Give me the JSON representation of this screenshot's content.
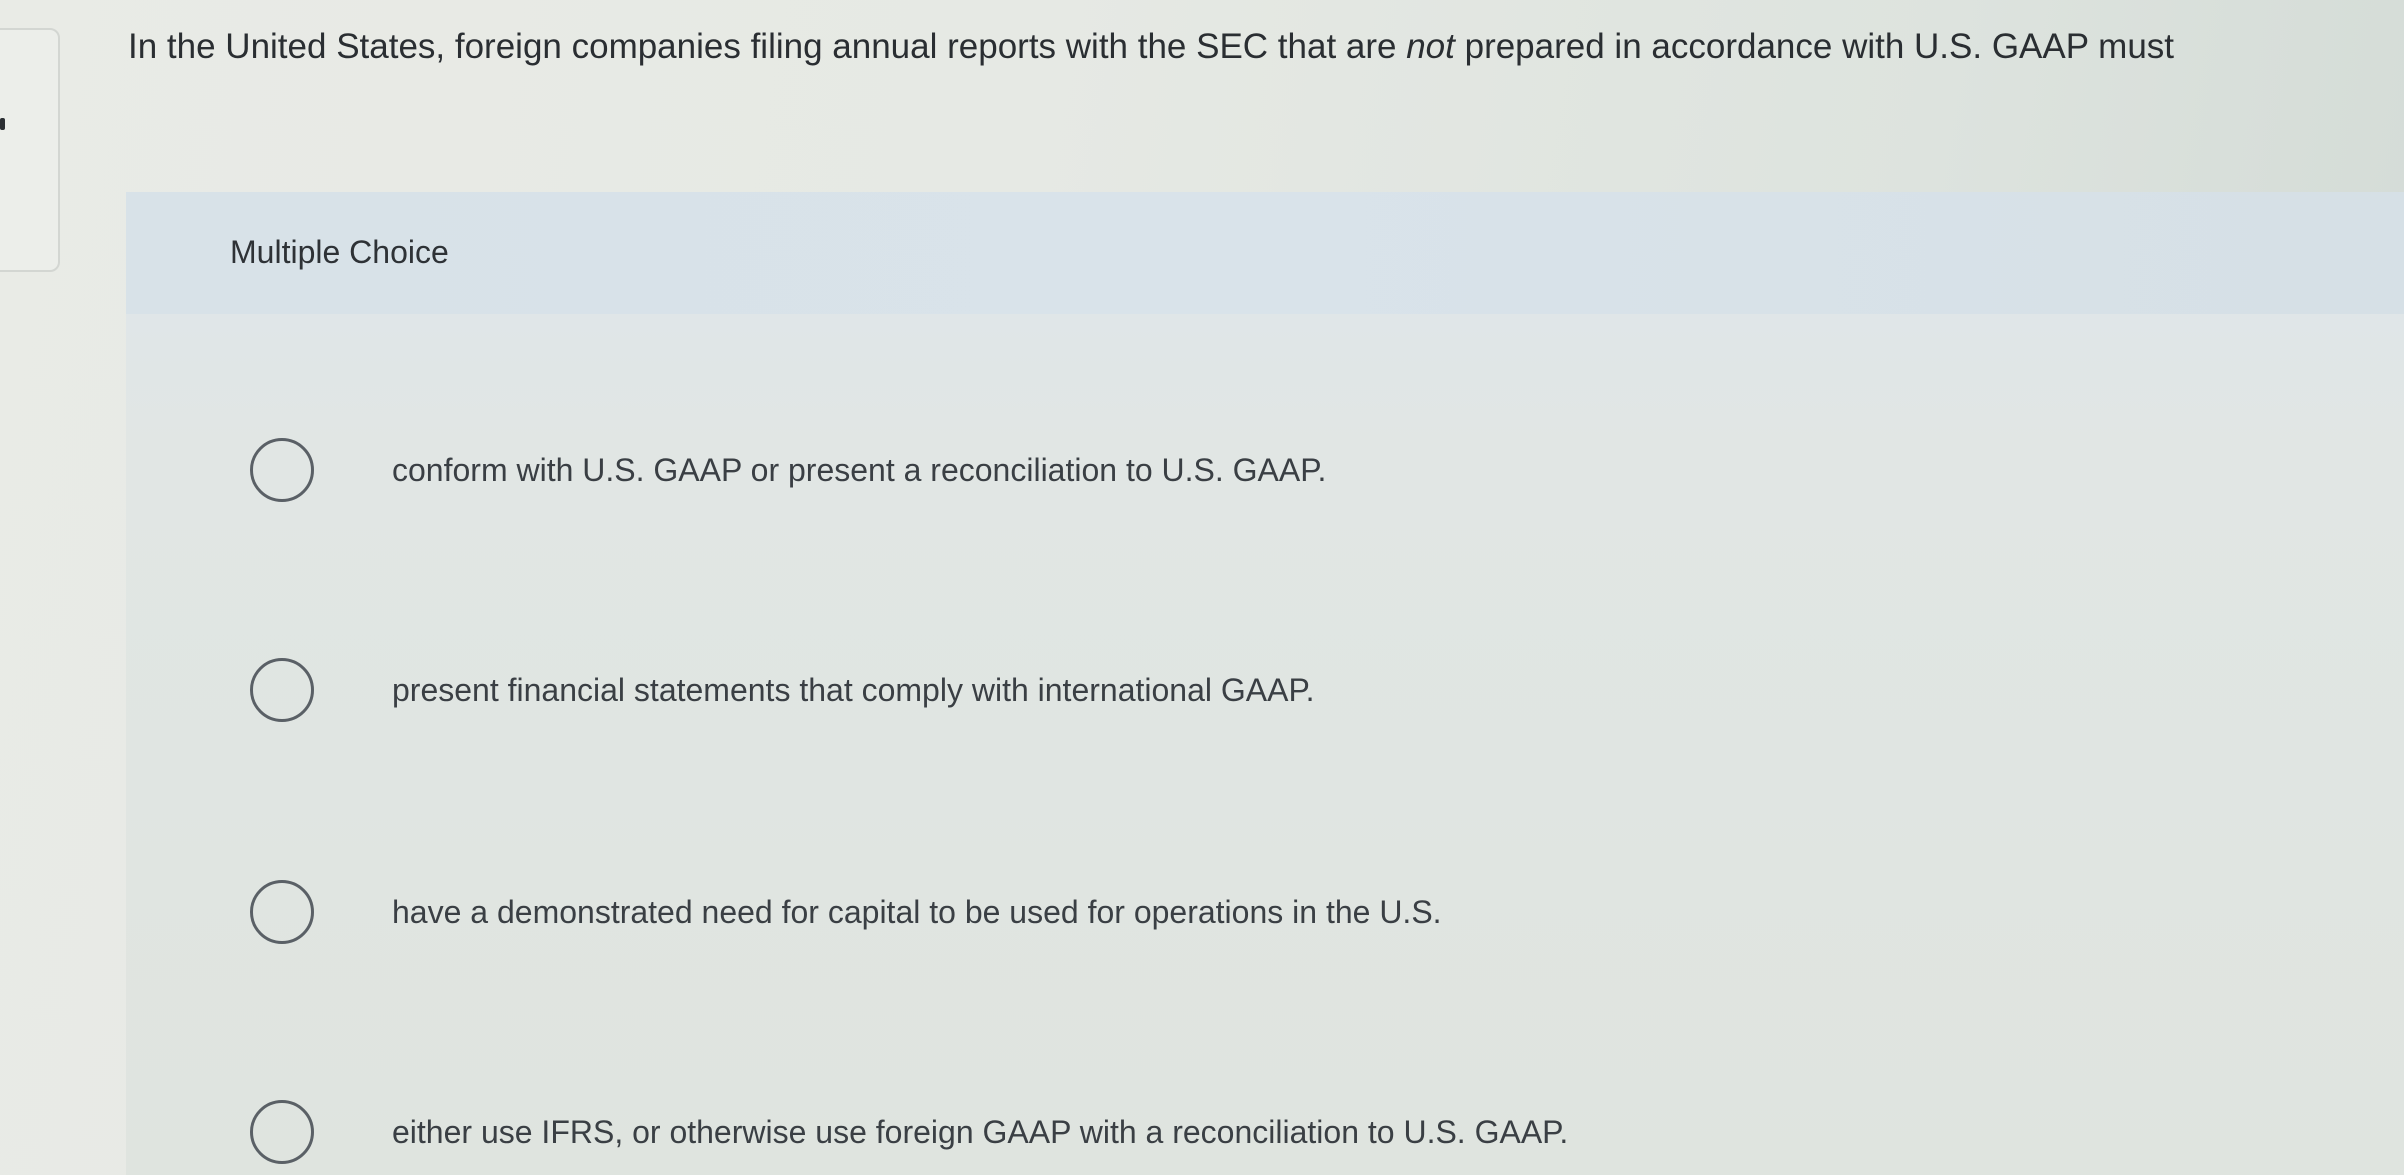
{
  "question": {
    "before": "In the United States, foreign companies filing annual reports with the SEC that are ",
    "emphasis": "not",
    "after": " prepared in accordance with U.S. GAAP must"
  },
  "multiple_choice": {
    "title": "Multiple Choice",
    "options": [
      {
        "label": "conform with U.S. GAAP or present a reconciliation to U.S. GAAP."
      },
      {
        "label": "present financial statements that comply with international GAAP."
      },
      {
        "label": "have a demonstrated need for capital to be used for operations in the U.S."
      },
      {
        "label": "either use IFRS, or otherwise use foreign GAAP with a reconciliation to U.S. GAAP."
      }
    ]
  },
  "icons": {
    "radio": "radio-unselected-icon"
  }
}
